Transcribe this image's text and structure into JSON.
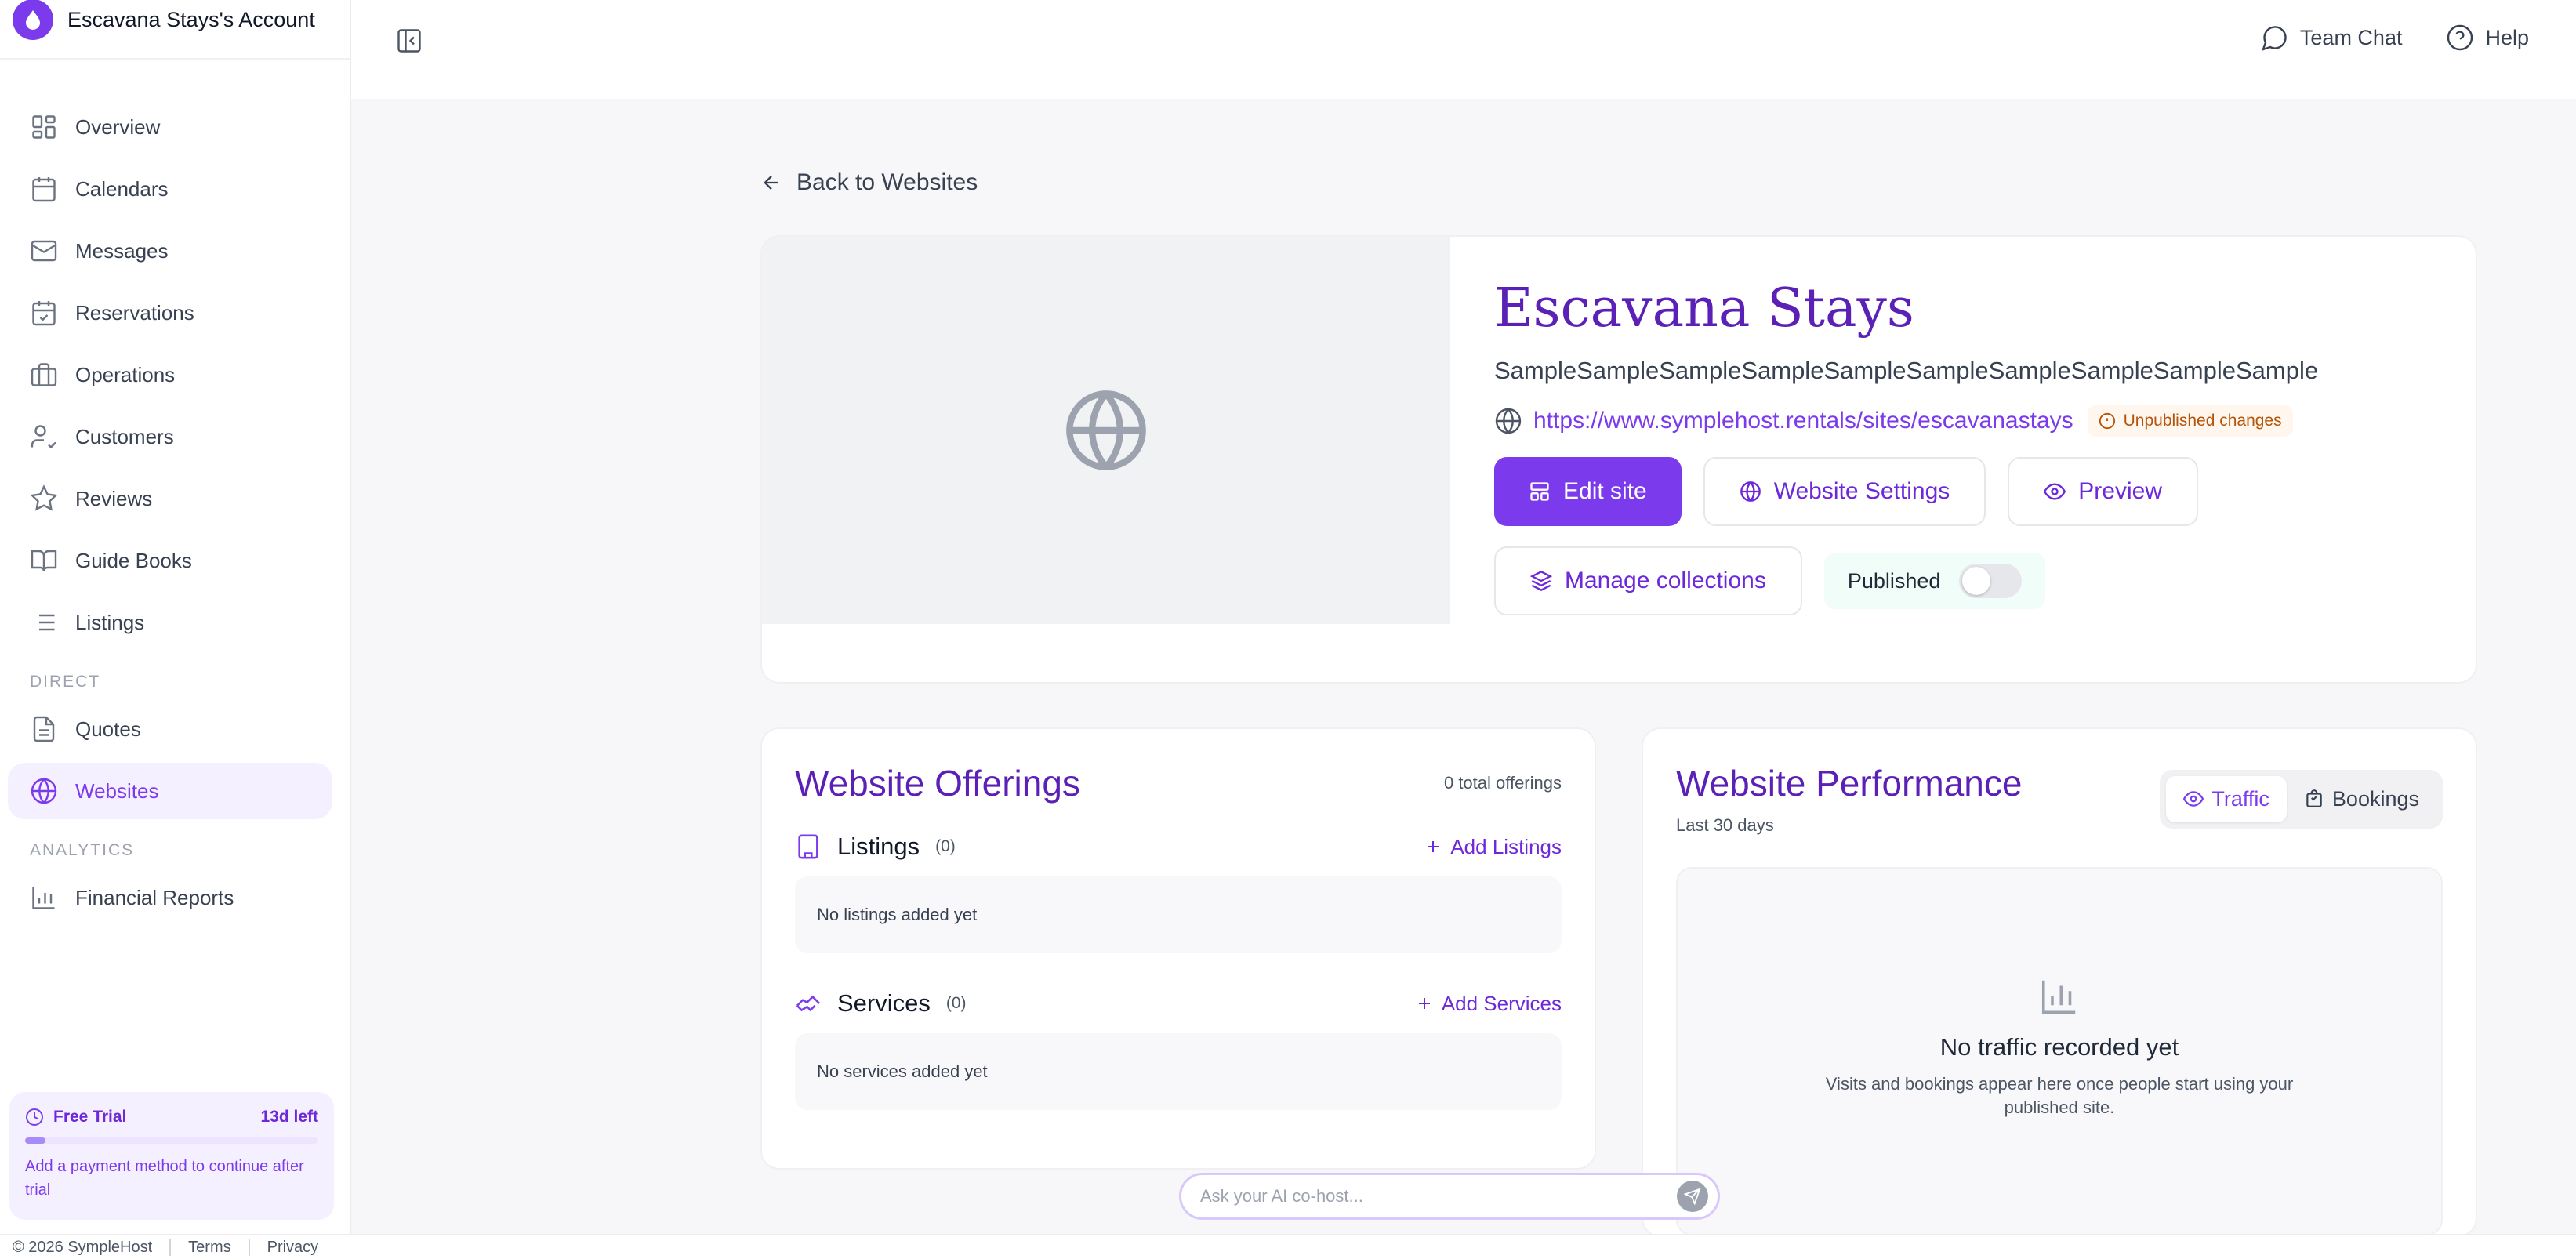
{
  "account": {
    "name": "Escavana Stays's Account"
  },
  "sidebar": {
    "items": [
      {
        "label": "Overview",
        "icon": "grid-icon"
      },
      {
        "label": "Calendars",
        "icon": "calendar-icon"
      },
      {
        "label": "Messages",
        "icon": "mail-icon"
      },
      {
        "label": "Reservations",
        "icon": "calendar-check-icon"
      },
      {
        "label": "Operations",
        "icon": "briefcase-icon"
      },
      {
        "label": "Customers",
        "icon": "user-check-icon"
      },
      {
        "label": "Reviews",
        "icon": "star-icon"
      },
      {
        "label": "Guide Books",
        "icon": "book-icon"
      },
      {
        "label": "Listings",
        "icon": "list-icon"
      }
    ],
    "direct_label": "DIRECT",
    "direct_items": [
      {
        "label": "Quotes",
        "icon": "file-icon"
      },
      {
        "label": "Websites",
        "icon": "globe-icon",
        "active": true
      }
    ],
    "analytics_label": "ANALYTICS",
    "analytics_items": [
      {
        "label": "Financial Reports",
        "icon": "bar-chart-icon"
      }
    ],
    "trial": {
      "title": "Free Trial",
      "days_left": "13d left",
      "progress": 0.07,
      "message": "Add a payment method to continue after trial"
    }
  },
  "topbar": {
    "team_chat": "Team Chat",
    "help": "Help"
  },
  "back_link": "Back to Websites",
  "site": {
    "name": "Escavana Stays",
    "description": "SampleSampleSampleSampleSampleSampleSampleSampleSampleSample",
    "url": "https://www.symplehost.rentals/sites/escavanastays",
    "badge": "Unpublished changes",
    "buttons": {
      "edit": "Edit site",
      "settings": "Website Settings",
      "preview": "Preview",
      "collections": "Manage collections"
    },
    "published_label": "Published",
    "published": false
  },
  "offerings": {
    "title": "Website Offerings",
    "total": "0 total offerings",
    "listings": {
      "title": "Listings",
      "count": "(0)",
      "add": "Add Listings",
      "empty": "No listings added yet"
    },
    "services": {
      "title": "Services",
      "count": "(0)",
      "add": "Add Services",
      "empty": "No services added yet"
    }
  },
  "performance": {
    "title": "Website Performance",
    "subtitle": "Last 30 days",
    "tabs": {
      "traffic": "Traffic",
      "bookings": "Bookings"
    },
    "active_tab": "Traffic",
    "empty_title": "No traffic recorded yet",
    "empty_desc": "Visits and bookings appear here once people start using your published site."
  },
  "ai": {
    "placeholder": "Ask your AI co-host..."
  },
  "footer": {
    "copyright": "© 2026 SympleHost",
    "terms": "Terms",
    "privacy": "Privacy"
  },
  "colors": {
    "accent": "#7c3aed",
    "accent_dark": "#5b21b6",
    "warning": "#b45309"
  }
}
